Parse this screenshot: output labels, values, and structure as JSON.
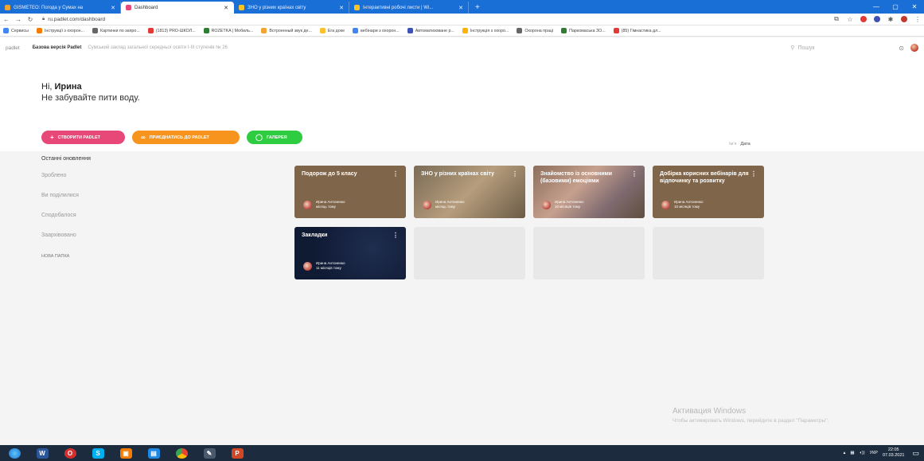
{
  "browser": {
    "tabs": [
      {
        "title": "GISMETEO: Погода у Сумах на",
        "color": "#f2a533",
        "active": false
      },
      {
        "title": "Dashboard",
        "color": "#e84877",
        "active": true
      },
      {
        "title": "ЗНО у різних країнах світу",
        "color": "#f7c325",
        "active": false
      },
      {
        "title": "Інтерактивні робочі листи | Wi...",
        "color": "#f7c325",
        "active": false
      }
    ],
    "new_tab": "+",
    "window_controls": {
      "minimize": "—",
      "maximize": "▢",
      "close": "✕"
    },
    "url": "ru.padlet.com/dashboard",
    "bookmarks": [
      {
        "label": "Сервисы",
        "color": "#4285f4"
      },
      {
        "label": "Інструкції з охорон...",
        "color": "#f57c00"
      },
      {
        "label": "Картинки по запро...",
        "color": "#666666"
      },
      {
        "label": "(1813) PRO-ШКОЛ...",
        "color": "#e53935"
      },
      {
        "label": "ROZETKA | Мобиль...",
        "color": "#2e7d32"
      },
      {
        "label": "Встроенный звук дe...",
        "color": "#f2a533"
      },
      {
        "label": "Ега доке",
        "color": "#fbc02d"
      },
      {
        "label": "вебінари з охорон...",
        "color": "#4285f4"
      },
      {
        "label": "Автоматизоване р...",
        "color": "#3f51b5"
      },
      {
        "label": "Інструкція з охоро...",
        "color": "#ffb300"
      },
      {
        "label": "Охорона праці",
        "color": "#666666"
      },
      {
        "label": "Паркомаська ЗО...",
        "color": "#2e7d32"
      },
      {
        "label": "(85) Гімнастика дл...",
        "color": "#e53935"
      }
    ]
  },
  "app": {
    "logo": "padlet",
    "plan": "Базова версія Padlet",
    "school": "Сумський заклад загальної середньої освіти I-III ступенів № 26",
    "search_placeholder": "Пошук"
  },
  "hero": {
    "greeting_prefix": "Hi, ",
    "user_name": "Ирина",
    "subtitle": "Не забувайте пити воду.",
    "buttons": [
      {
        "icon": "+",
        "label": "СТВОРИТИ PADLET"
      },
      {
        "icon": "∞",
        "label": "ПРИЄДНАТИСЬ ДО PADLET"
      },
      {
        "icon": "◯",
        "label": "ГАЛЕРЕЯ"
      }
    ]
  },
  "sort": {
    "left": "Імʼя",
    "right": "Дата"
  },
  "sidebar": {
    "header": "Останні оновлення",
    "items": [
      "Зроблено",
      "Ви поділилися",
      "Сподобалося",
      "Заархівовано"
    ],
    "new_folder": "НОВА ПАПКА"
  },
  "cards": [
    {
      "title": "Подорож до 5 класу",
      "author": "Ирина Антоненко",
      "when": "місяць тому"
    },
    {
      "title": "ЗНО у різних країнах світу",
      "author": "Ирина Антоненко",
      "when": "місяць тому"
    },
    {
      "title": "Знайомство із основними (базовими) емоціями",
      "author": "Ирина Антоненко",
      "when": "10 місяців тому"
    },
    {
      "title": "Добірка корисних вебінарів для відпочинку та розвитку",
      "author": "Ирина Антоненко",
      "when": "10 місяців тому"
    },
    {
      "title": "Закладки",
      "author": "Ирина Антоненко",
      "when": "11 місяців тому"
    }
  ],
  "activation": {
    "title": "Активация Windows",
    "text": "Чтобы активировать Windows, перейдите в раздел \"Параметры\"."
  },
  "taskbar": {
    "language": "УКР",
    "time": "22:05",
    "date": "07.03.2021"
  }
}
